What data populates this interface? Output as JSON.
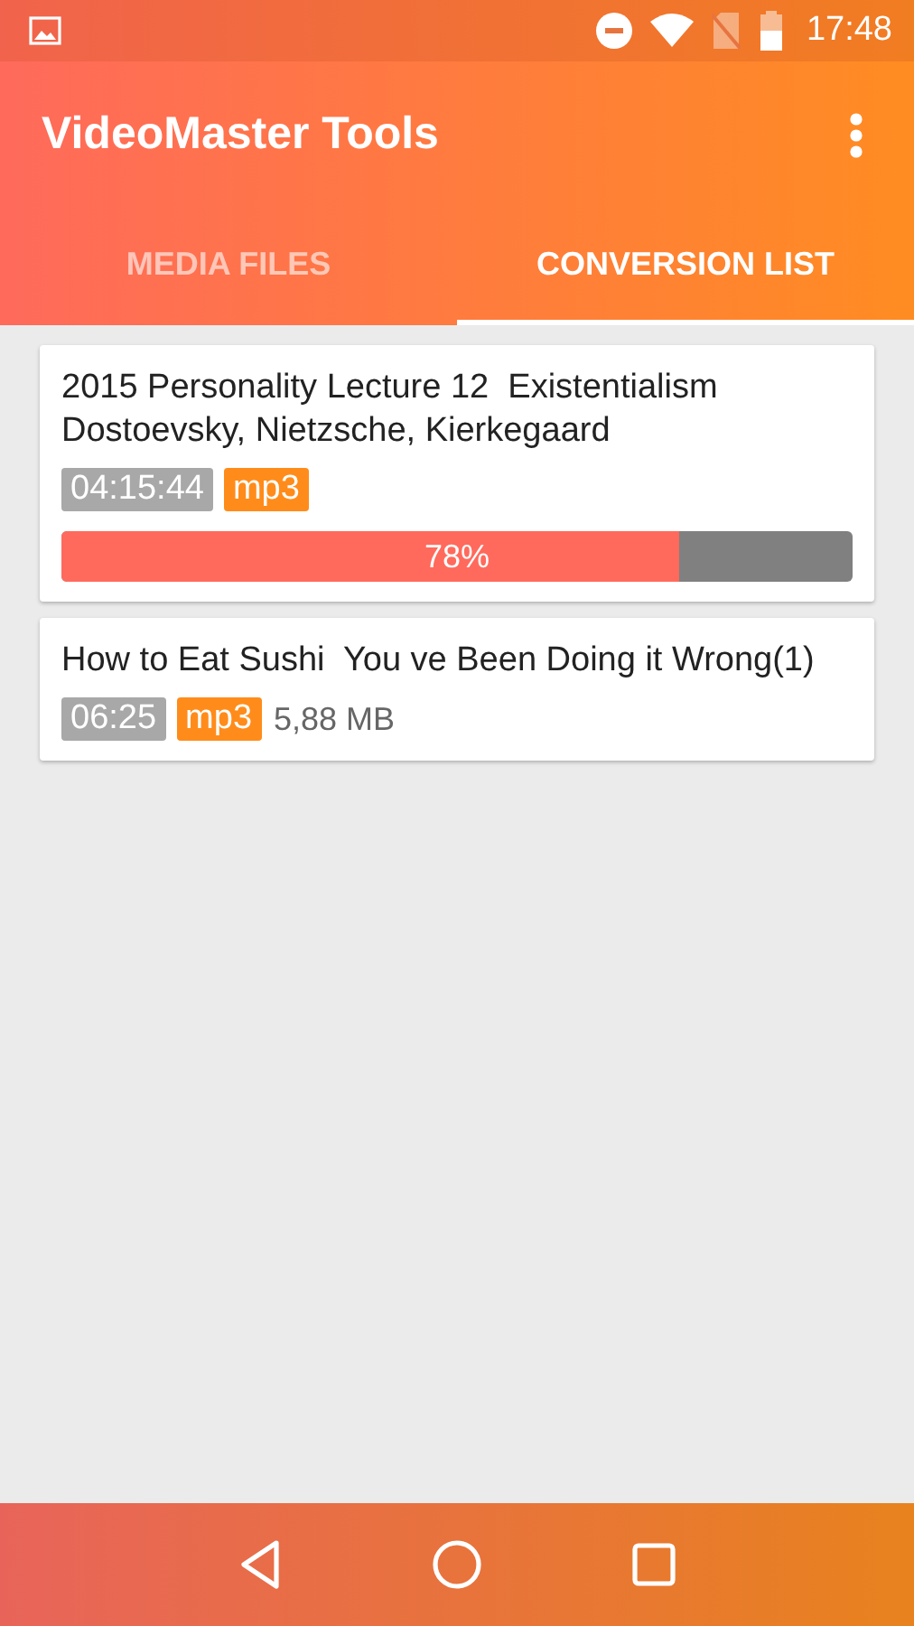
{
  "status_bar": {
    "time": "17:48"
  },
  "app_bar": {
    "title": "VideoMaster Tools"
  },
  "tabs": [
    {
      "label": "MEDIA FILES",
      "selected": false
    },
    {
      "label": "CONVERSION LIST",
      "selected": true
    }
  ],
  "items": [
    {
      "title": "2015 Personality Lecture 12  Existentialism Dostoevsky, Nietzsche, Kierkegaard",
      "duration": "04:15:44",
      "format": "mp3",
      "progress": {
        "level": 0.78,
        "label": "78%"
      }
    },
    {
      "title": "How to Eat Sushi  You ve Been Doing it Wrong(1)",
      "duration": "06:25",
      "format": "mp3",
      "size": "5,88 MB"
    }
  ]
}
